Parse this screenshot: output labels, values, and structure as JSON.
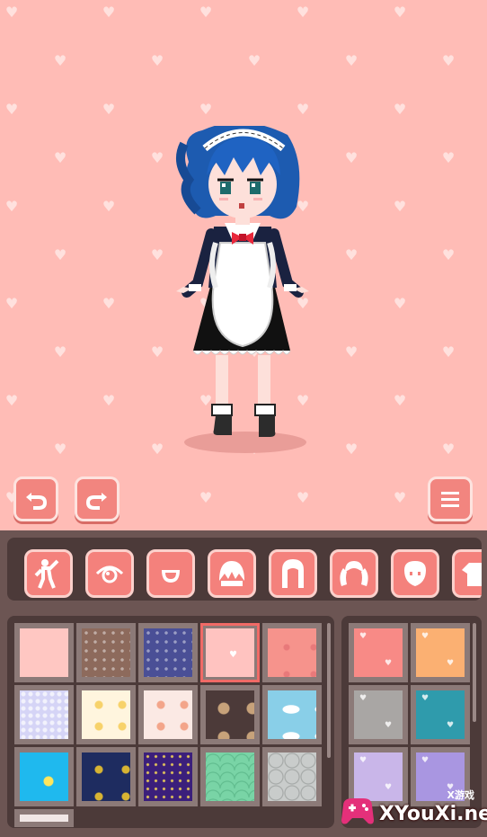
{
  "toolbar": {
    "undo_icon": "undo-arrow-icon",
    "redo_icon": "redo-arrow-icon",
    "menu_icon": "hamburger-menu-icon"
  },
  "categories": [
    {
      "id": "pose",
      "icon": "body-pose-icon",
      "active": false
    },
    {
      "id": "eyes",
      "icon": "eye-icon",
      "active": false
    },
    {
      "id": "mouth",
      "icon": "mouth-icon",
      "active": false
    },
    {
      "id": "bangs",
      "icon": "front-hair-icon",
      "active": false
    },
    {
      "id": "hair",
      "icon": "long-hair-icon",
      "active": false
    },
    {
      "id": "pigtails",
      "icon": "pigtail-hair-icon",
      "active": false
    },
    {
      "id": "face",
      "icon": "face-shape-icon",
      "active": false
    },
    {
      "id": "top",
      "icon": "shirt-icon",
      "active": false
    }
  ],
  "backgrounds": [
    {
      "name": "plain-pink",
      "color": "#ffc7c2",
      "pattern": "plain",
      "selected": false
    },
    {
      "name": "brown-dots",
      "color": "#8d6a5c",
      "pattern": "dots",
      "selected": false
    },
    {
      "name": "navy-dots",
      "color": "#4a4f96",
      "pattern": "dots",
      "selected": false
    },
    {
      "name": "pink-hearts",
      "color": "#ffc3c0",
      "pattern": "heart",
      "selected": true
    },
    {
      "name": "coral-bows",
      "color": "#f6938c",
      "pattern": "bows",
      "selected": false
    },
    {
      "name": "lavender-lace",
      "color": "#d5d4f6",
      "pattern": "lace",
      "selected": false
    },
    {
      "name": "cream-lemons",
      "color": "#fff5de",
      "pattern": "lemon",
      "selected": false
    },
    {
      "name": "white-citrus",
      "color": "#fbe9e4",
      "pattern": "citrus",
      "selected": false
    },
    {
      "name": "cocoa-cookies",
      "color": "#4c3a39",
      "pattern": "cookies",
      "selected": false
    },
    {
      "name": "sky-clouds",
      "color": "#89cfe8",
      "pattern": "clouds",
      "selected": false
    },
    {
      "name": "bright-sky-sun",
      "color": "#1fb9ee",
      "pattern": "sun",
      "selected": false
    },
    {
      "name": "night-stars",
      "color": "#1e2c60",
      "pattern": "stars",
      "selected": false
    },
    {
      "name": "purple-night",
      "color": "#3b1f7b",
      "pattern": "tinystars",
      "selected": false
    },
    {
      "name": "mint-scales",
      "color": "#79d4a6",
      "pattern": "scales",
      "selected": false
    },
    {
      "name": "grey-tiles",
      "color": "#c9cccb",
      "pattern": "tiles",
      "selected": false
    }
  ],
  "colors": [
    {
      "name": "pink",
      "color": "#f88a86"
    },
    {
      "name": "peach",
      "color": "#fbb072"
    },
    {
      "name": "grey",
      "color": "#a9a6a4"
    },
    {
      "name": "teal",
      "color": "#2f9bac"
    },
    {
      "name": "lilac",
      "color": "#c9b6e9"
    },
    {
      "name": "lavender",
      "color": "#a996e1"
    }
  ],
  "watermark": {
    "top_text": "X游戏",
    "main_text": "XYouXi.net"
  },
  "theme": {
    "accent": "#f4817c",
    "panel": "#6c5553",
    "panel_dark": "#4c3a39",
    "stage_bg": "#ffbcb6"
  }
}
